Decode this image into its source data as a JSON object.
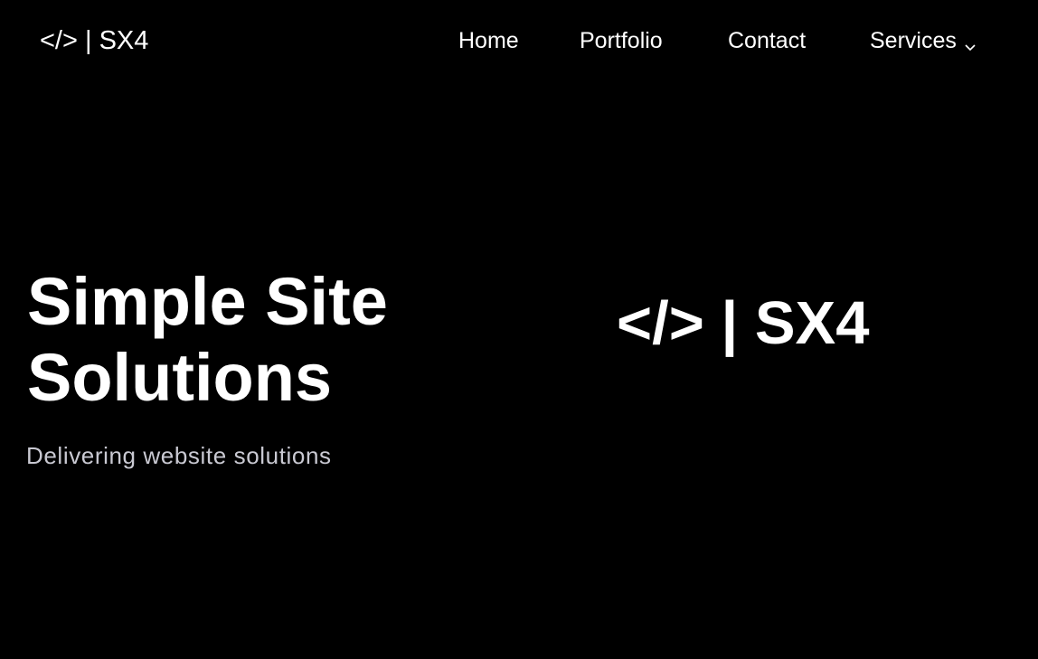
{
  "header": {
    "brand": "</> | SX4",
    "nav": {
      "home": "Home",
      "portfolio": "Portfolio",
      "contact": "Contact",
      "services": "Services"
    },
    "services_icon": "chevron-down-icon"
  },
  "hero": {
    "title_line1": "Simple Site",
    "title_line2": "Solutions",
    "subtitle": "Delivering website solutions",
    "logo_text": "</> | SX4"
  },
  "colors": {
    "background": "#000000",
    "text": "#ffffff",
    "subtitle": "#c9c9d2"
  }
}
